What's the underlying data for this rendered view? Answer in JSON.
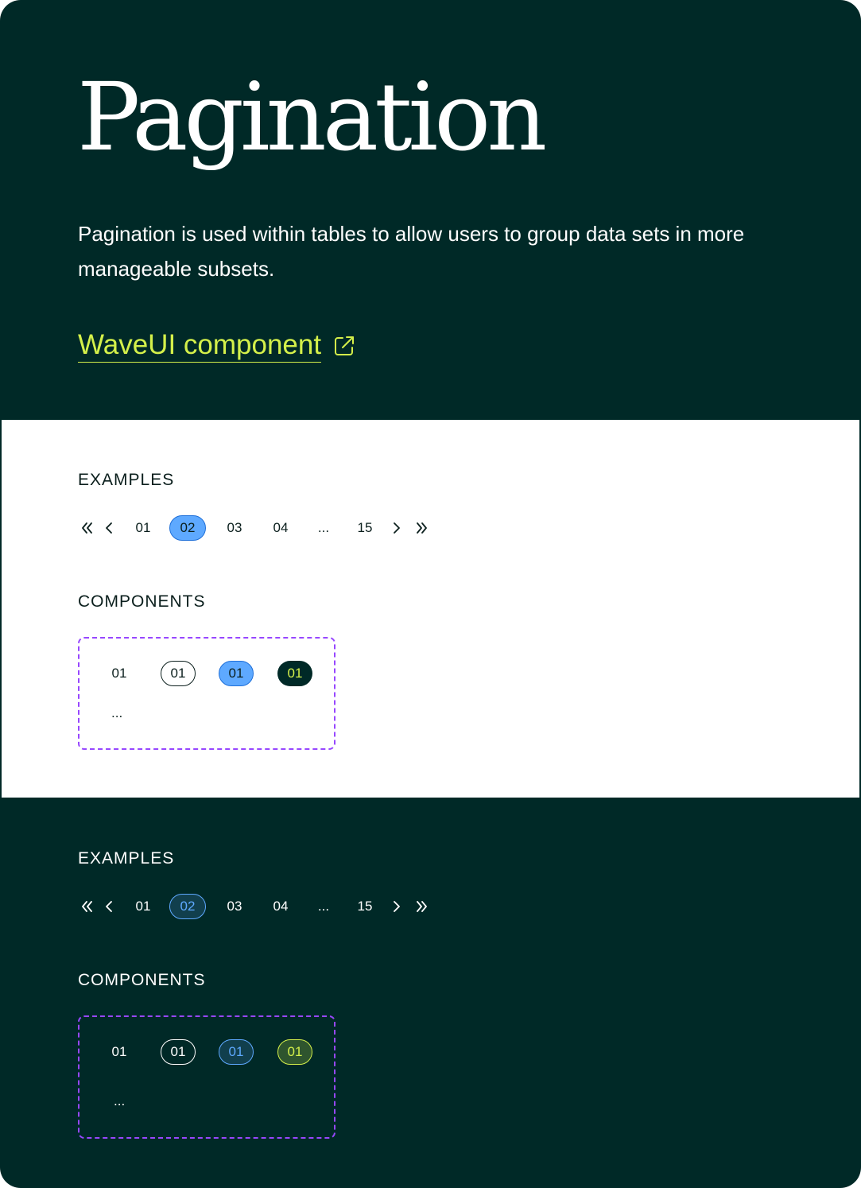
{
  "hero": {
    "title": "Pagination",
    "description": "Pagination is used within tables to allow users to group data sets in more manageable subsets.",
    "link_label": "WaveUI component",
    "link_icon": "external-link-icon"
  },
  "colors": {
    "background_dark": "#002927",
    "background_light": "#ffffff",
    "accent_lime": "#d4f04a",
    "accent_blue": "#5ea9ff",
    "component_border": "#9747ff"
  },
  "light_section": {
    "examples_label": "EXAMPLES",
    "components_label": "COMPONENTS",
    "pager": {
      "first_icon": "double-chevron-left-icon",
      "prev_icon": "chevron-left-icon",
      "pages": [
        "01",
        "02",
        "03",
        "04",
        "...",
        "15"
      ],
      "active_page": "02",
      "next_icon": "chevron-right-icon",
      "last_icon": "double-chevron-right-icon"
    },
    "components": {
      "default": "01",
      "outlined": "01",
      "selected": "01",
      "filled": "01",
      "ellipsis": "..."
    }
  },
  "dark_section": {
    "examples_label": "EXAMPLES",
    "components_label": "COMPONENTS",
    "pager": {
      "first_icon": "double-chevron-left-icon",
      "prev_icon": "chevron-left-icon",
      "pages": [
        "01",
        "02",
        "03",
        "04",
        "...",
        "15"
      ],
      "active_page": "02",
      "next_icon": "chevron-right-icon",
      "last_icon": "double-chevron-right-icon"
    },
    "components": {
      "default": "01",
      "outlined": "01",
      "selected": "01",
      "filled": "01",
      "ellipsis": "..."
    }
  }
}
